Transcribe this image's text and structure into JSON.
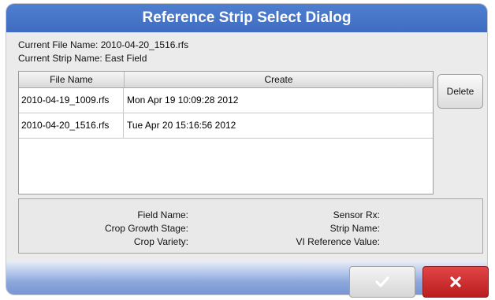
{
  "dialog": {
    "title": "Reference Strip Select Dialog",
    "current_file_label": "Current File Name: 2010-04-20_1516.rfs",
    "current_strip_label": "Current Strip Name: East Field"
  },
  "table": {
    "columns": [
      "File Name",
      "Create"
    ],
    "rows": [
      {
        "file": "2010-04-19_1009.rfs",
        "created": "Mon Apr 19 10:09:28 2012"
      },
      {
        "file": "2010-04-20_1516.rfs",
        "created": "Tue Apr 20 15:16:56 2012"
      }
    ]
  },
  "actions": {
    "delete_label": "Delete"
  },
  "details": {
    "field_name": "Field Name:",
    "crop_growth_stage": "Crop Growth Stage:",
    "crop_variety": "Crop Variety:",
    "sensor_rx": "Sensor Rx:",
    "strip_name": "Strip Name:",
    "vi_reference_value": "VI Reference Value:"
  },
  "footer": {
    "ok_icon": "checkmark-icon",
    "cancel_icon": "close-x-icon"
  },
  "colors": {
    "title_bar": "#466fc6",
    "cancel": "#c82b2b",
    "dialog_bg": "#ebebeb"
  }
}
